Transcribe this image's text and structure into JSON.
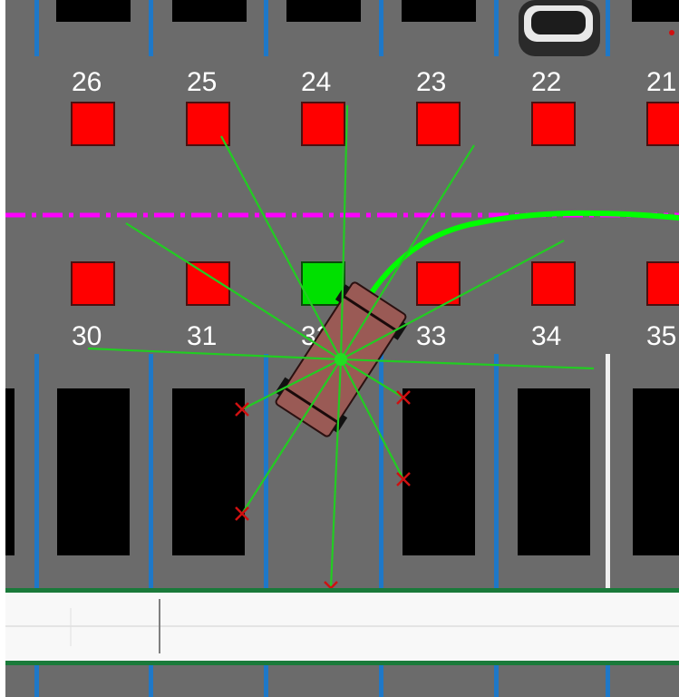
{
  "scene": {
    "type": "top-down parking simulation",
    "colors": {
      "asphalt": "#6b6b6b",
      "occupied_marker": "#ff0000",
      "target_marker": "#00e000",
      "lane_divider": "#ff00ff",
      "stall_line": "#1e78c8",
      "parked_car": "#000000",
      "ego_vehicle": "#9a5a55",
      "sensor_ray": "#22cc22",
      "ray_hit": "#d01010",
      "planned_path": "#00ff00",
      "curb": "#1a7a3a",
      "sidewalk": "#f8f8f8"
    }
  },
  "parking_slots": {
    "top_row": [
      {
        "label": "26",
        "status": "occupied"
      },
      {
        "label": "25",
        "status": "occupied"
      },
      {
        "label": "24",
        "status": "occupied"
      },
      {
        "label": "23",
        "status": "occupied"
      },
      {
        "label": "22",
        "status": "occupied"
      },
      {
        "label": "21",
        "status": "occupied"
      }
    ],
    "bottom_row": [
      {
        "label": "30",
        "status": "occupied"
      },
      {
        "label": "31",
        "status": "occupied"
      },
      {
        "label": "32",
        "status": "target"
      },
      {
        "label": "33",
        "status": "occupied"
      },
      {
        "label": "34",
        "status": "occupied"
      },
      {
        "label": "35",
        "status": "occupied"
      }
    ]
  },
  "ego_vehicle": {
    "heading_deg": 33,
    "sensor_rays": 12,
    "rays_with_hits": 5
  }
}
